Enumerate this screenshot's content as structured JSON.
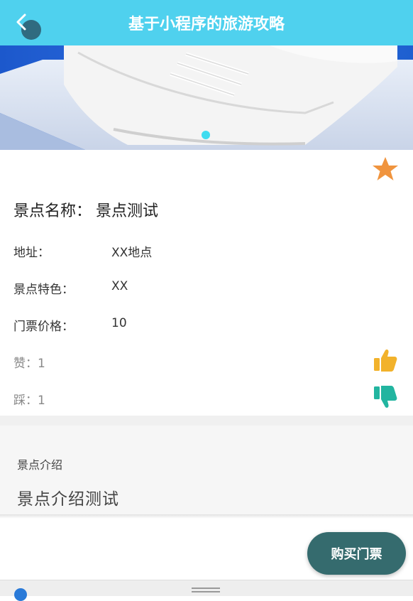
{
  "header": {
    "title": "基于小程序的旅游攻略",
    "back_icon": "chevron-left-icon"
  },
  "favorite": {
    "icon": "star-icon",
    "color": "#f0943e"
  },
  "name": {
    "label": "景点名称：",
    "value": "景点测试"
  },
  "details": [
    {
      "label": "地址：",
      "value": "XX地点"
    },
    {
      "label": "景点特色：",
      "value": "XX"
    },
    {
      "label": "门票价格：",
      "value": "10"
    }
  ],
  "likes": {
    "label": "赞：",
    "value": "1",
    "icon": "thumbs-up-icon",
    "color": "#f2b22b"
  },
  "dislikes": {
    "label": "踩：",
    "value": "1",
    "icon": "thumbs-down-icon",
    "color": "#22b5a0"
  },
  "intro": {
    "label": "景点介绍",
    "text": "景点介绍测试"
  },
  "buy_button": {
    "label": "购买门票",
    "color": "#356b6e"
  },
  "colors": {
    "header": "#4fd1ee",
    "banner_bg": "#1e5fd0"
  }
}
